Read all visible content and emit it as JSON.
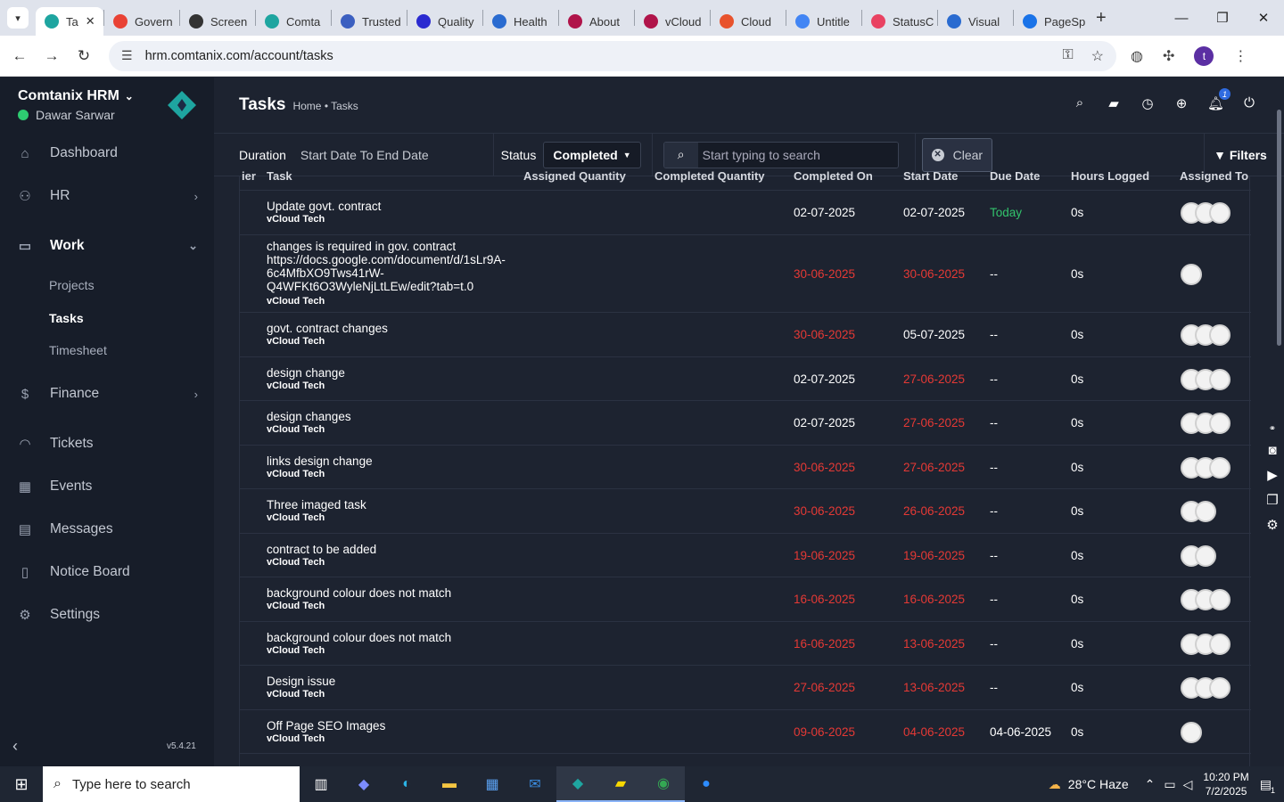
{
  "browser": {
    "tabs": [
      {
        "label": "Ta",
        "color": "#1ea5a0",
        "active": true
      },
      {
        "label": "Govern",
        "color": "#e94235"
      },
      {
        "label": "Screen",
        "color": "#333333"
      },
      {
        "label": "Comta",
        "color": "#1ea5a0"
      },
      {
        "label": "Trusted",
        "color": "#3b5fc0"
      },
      {
        "label": "Quality",
        "color": "#2a2ad0"
      },
      {
        "label": "Health",
        "color": "#2a6bd0"
      },
      {
        "label": "About",
        "color": "#b0144a"
      },
      {
        "label": "vCloud",
        "color": "#b0144a"
      },
      {
        "label": "Cloud",
        "color": "#e8532d"
      },
      {
        "label": "Untitle",
        "color": "#4285f4"
      },
      {
        "label": "StatusC",
        "color": "#e94262"
      },
      {
        "label": "Visual",
        "color": "#2a6bd0"
      },
      {
        "label": "PageSp",
        "color": "#1a73e8"
      }
    ],
    "url": "hrm.comtanix.com/account/tasks"
  },
  "sidebar": {
    "brand": "Comtanix HRM",
    "user": "Dawar Sarwar",
    "menu": [
      {
        "label": "Dashboard",
        "icon": "home-icon"
      },
      {
        "label": "HR",
        "icon": "users-icon"
      },
      {
        "label": "Work",
        "icon": "briefcase-icon"
      },
      {
        "label": "Finance",
        "icon": "dollar-icon"
      },
      {
        "label": "Tickets",
        "icon": "headset-icon"
      },
      {
        "label": "Events",
        "icon": "calendar-icon"
      },
      {
        "label": "Messages",
        "icon": "message-icon"
      },
      {
        "label": "Notice Board",
        "icon": "clipboard-icon"
      },
      {
        "label": "Settings",
        "icon": "gear-icon"
      }
    ],
    "work_sub": [
      "Projects",
      "Tasks",
      "Timesheet"
    ],
    "version": "v5.4.21"
  },
  "header": {
    "title": "Tasks",
    "breadcrumb": "Home • Tasks",
    "notif_count": "1"
  },
  "filters": {
    "duration_label": "Duration",
    "duration_value": "Start Date To End Date",
    "status_label": "Status",
    "status_value": "Completed",
    "search_placeholder": "Start typing to search",
    "clear_label": "Clear",
    "filters_label": "Filters"
  },
  "table": {
    "columns": [
      "ier",
      "Task",
      "Assigned Quantity",
      "Completed Quantity",
      "Completed On",
      "Start Date",
      "Due Date",
      "Hours Logged",
      "Assigned To"
    ],
    "rows": [
      {
        "task": "Update govt. contract",
        "project": "vCloud Tech",
        "completed": "02-07-2025",
        "start": "02-07-2025",
        "due": "Today",
        "hours": "0s",
        "avatars": 3
      },
      {
        "task": "changes is required in gov. contract https://docs.google.com/document/d/1sLr9A-6c4MfbXO9Tws41rW-Q4WFKt6O3WyleNjLtLEw/edit?tab=t.0",
        "project": "vCloud Tech",
        "completed": "30-06-2025",
        "start": "30-06-2025",
        "due": "--",
        "hours": "0s",
        "avatars": 1
      },
      {
        "task": "govt. contract changes",
        "project": "vCloud Tech",
        "completed": "30-06-2025",
        "start": "05-07-2025",
        "due": "--",
        "hours": "0s",
        "avatars": 3
      },
      {
        "task": "design change",
        "project": "vCloud Tech",
        "completed": "02-07-2025",
        "start": "27-06-2025",
        "due": "--",
        "hours": "0s",
        "avatars": 3
      },
      {
        "task": "design changes",
        "project": "vCloud Tech",
        "completed": "02-07-2025",
        "start": "27-06-2025",
        "due": "--",
        "hours": "0s",
        "avatars": 3
      },
      {
        "task": "links design change",
        "project": "vCloud Tech",
        "completed": "30-06-2025",
        "start": "27-06-2025",
        "due": "--",
        "hours": "0s",
        "avatars": 3
      },
      {
        "task": "Three imaged task",
        "project": "vCloud Tech",
        "completed": "30-06-2025",
        "start": "26-06-2025",
        "due": "--",
        "hours": "0s",
        "avatars": 2
      },
      {
        "task": "contract to be added",
        "project": "vCloud Tech",
        "completed": "19-06-2025",
        "start": "19-06-2025",
        "due": "--",
        "hours": "0s",
        "avatars": 2
      },
      {
        "task": "background colour does not match",
        "project": "vCloud Tech",
        "completed": "16-06-2025",
        "start": "16-06-2025",
        "due": "--",
        "hours": "0s",
        "avatars": 3
      },
      {
        "task": "background colour does not match",
        "project": "vCloud Tech",
        "completed": "16-06-2025",
        "start": "13-06-2025",
        "due": "--",
        "hours": "0s",
        "avatars": 3
      },
      {
        "task": "Design issue",
        "project": "vCloud Tech",
        "completed": "27-06-2025",
        "start": "13-06-2025",
        "due": "--",
        "hours": "0s",
        "avatars": 3
      },
      {
        "task": "Off Page SEO Images",
        "project": "vCloud Tech",
        "completed": "09-06-2025",
        "start": "04-06-2025",
        "due": "04-06-2025",
        "hours": "0s",
        "avatars": 1
      }
    ]
  },
  "taskbar": {
    "search_placeholder": "Type here to search",
    "weather": "28°C  Haze",
    "time": "10:20 PM",
    "date": "7/2/2025",
    "notif": "1"
  }
}
